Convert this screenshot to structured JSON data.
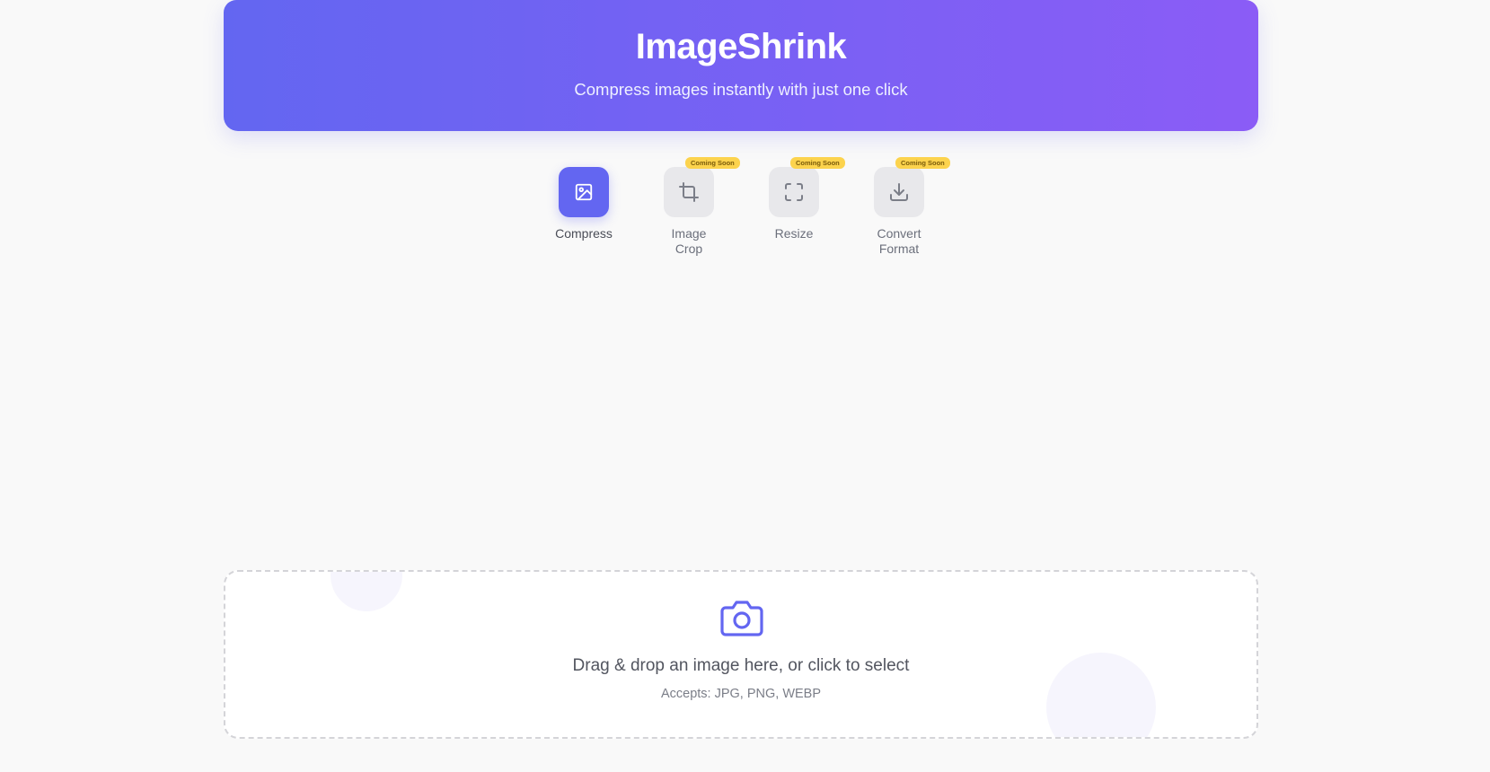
{
  "header": {
    "title": "ImageShrink",
    "subtitle": "Compress images instantly with just one click"
  },
  "tools": [
    {
      "label": "Compress",
      "icon": "image-icon",
      "active": true,
      "badge": ""
    },
    {
      "label": "Image Crop",
      "icon": "crop-icon",
      "active": false,
      "badge": "Coming Soon"
    },
    {
      "label": "Resize",
      "icon": "fullscreen-icon",
      "active": false,
      "badge": "Coming Soon"
    },
    {
      "label": "Convert Format",
      "icon": "download-icon",
      "active": false,
      "badge": "Coming Soon"
    }
  ],
  "dropzone": {
    "icon": "camera-icon",
    "title": "Drag & drop an image here, or click to select",
    "subtitle": "Accepts: JPG, PNG, WEBP"
  },
  "colors": {
    "gradient_start": "#6366f1",
    "gradient_end": "#8b5cf6",
    "accent": "#6366f1",
    "badge": "#fcd34d"
  }
}
